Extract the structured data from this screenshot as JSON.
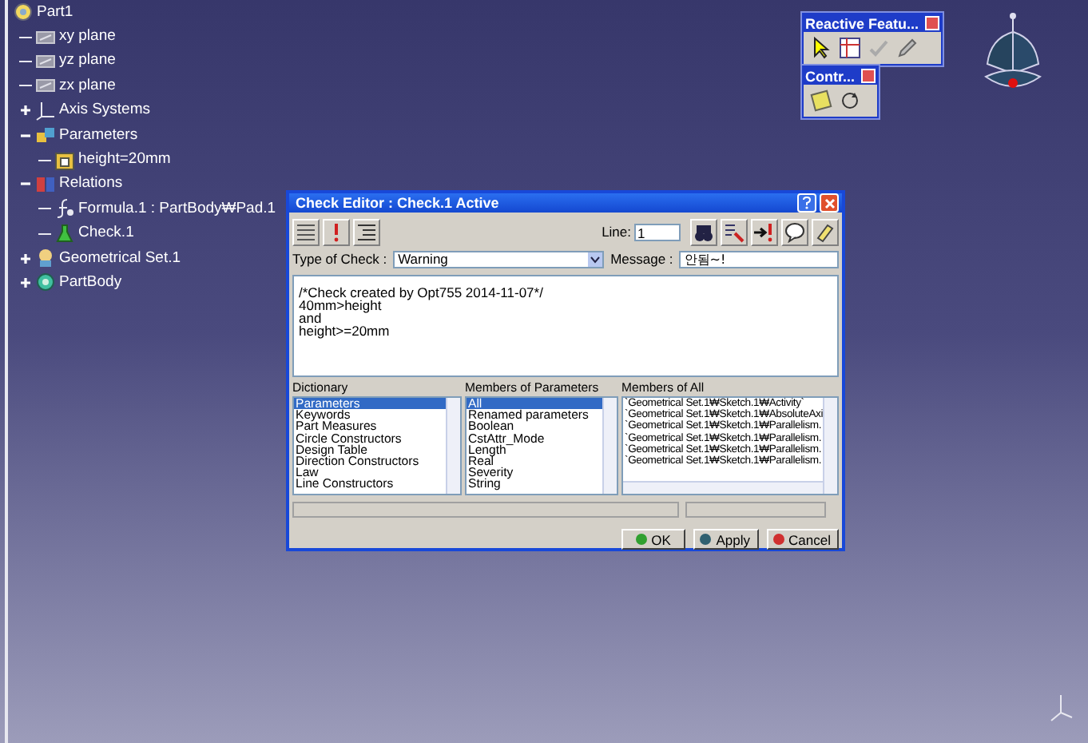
{
  "tree": {
    "label": "Part1",
    "kind": "part",
    "children": [
      {
        "label": "xy plane",
        "kind": "plane"
      },
      {
        "label": "yz plane",
        "kind": "plane"
      },
      {
        "label": "zx plane",
        "kind": "plane"
      },
      {
        "label": "Axis Systems",
        "kind": "axis",
        "expanded": false
      },
      {
        "label": "Parameters",
        "kind": "parameters",
        "expanded": true,
        "children": [
          {
            "label": "height=20mm",
            "kind": "parameter"
          }
        ]
      },
      {
        "label": "Relations",
        "kind": "relations",
        "expanded": true,
        "children": [
          {
            "label": "Formula.1 : PartBody₩Pad.1",
            "kind": "formula"
          },
          {
            "label": "Check.1",
            "kind": "check"
          }
        ]
      },
      {
        "label": "Geometrical Set.1",
        "kind": "geoset",
        "expanded": false
      },
      {
        "label": "PartBody",
        "kind": "body",
        "expanded": false
      }
    ]
  },
  "toolbars": [
    {
      "title": "Reactive Featu...",
      "tools": [
        {
          "kind": "cursor"
        },
        {
          "kind": "table"
        },
        {
          "kind": "check"
        },
        {
          "kind": "pencil"
        }
      ]
    },
    {
      "title": "Contr...",
      "tools": [
        {
          "kind": "note"
        },
        {
          "kind": "loop"
        }
      ]
    }
  ],
  "dialog": {
    "title": "Check Editor : Check.1 Active",
    "line_label": "Line:",
    "line_value": "1",
    "type_label": "Type of Check :",
    "type_value": "Warning",
    "message_label": "Message :",
    "message_value": "안됨~!",
    "editor_lines": [
      "/*Check created by Opt755 2014-11-07*/",
      "40mm>height",
      "and",
      "height>=20mm"
    ],
    "lists": [
      {
        "title": "Dictionary",
        "items": [
          {
            "label": "Parameters",
            "selected": true
          },
          {
            "label": "Keywords",
            "selected": false
          },
          {
            "label": "Part Measures",
            "selected": false
          },
          {
            "label": "Circle Constructors",
            "selected": false
          },
          {
            "label": "Design Table",
            "selected": false
          },
          {
            "label": "Direction Constructors",
            "selected": false
          },
          {
            "label": "Law",
            "selected": false
          },
          {
            "label": "Line Constructors",
            "selected": false
          }
        ]
      },
      {
        "title": "Members of Parameters",
        "items": [
          {
            "label": "All",
            "selected": true
          },
          {
            "label": "Renamed parameters",
            "selected": false
          },
          {
            "label": "Boolean",
            "selected": false
          },
          {
            "label": "CstAttr_Mode",
            "selected": false
          },
          {
            "label": "Length",
            "selected": false
          },
          {
            "label": "Real",
            "selected": false
          },
          {
            "label": "Severity",
            "selected": false
          },
          {
            "label": "String",
            "selected": false
          }
        ]
      },
      {
        "title": "Members of All",
        "items": [
          {
            "label": "`Geometrical Set.1₩Sketch.1₩Activity`",
            "selected": false
          },
          {
            "label": "`Geometrical Set.1₩Sketch.1₩AbsoluteAxi",
            "selected": false
          },
          {
            "label": "`Geometrical Set.1₩Sketch.1₩Parallelism.",
            "selected": false
          },
          {
            "label": "`Geometrical Set.1₩Sketch.1₩Parallelism.",
            "selected": false
          },
          {
            "label": "`Geometrical Set.1₩Sketch.1₩Parallelism.",
            "selected": false
          },
          {
            "label": "`Geometrical Set.1₩Sketch.1₩Parallelism.",
            "selected": false
          }
        ]
      }
    ],
    "buttons": [
      {
        "label": "OK",
        "kind": "ok"
      },
      {
        "label": "Apply",
        "kind": "apply"
      },
      {
        "label": "Cancel",
        "kind": "cancel"
      }
    ]
  }
}
